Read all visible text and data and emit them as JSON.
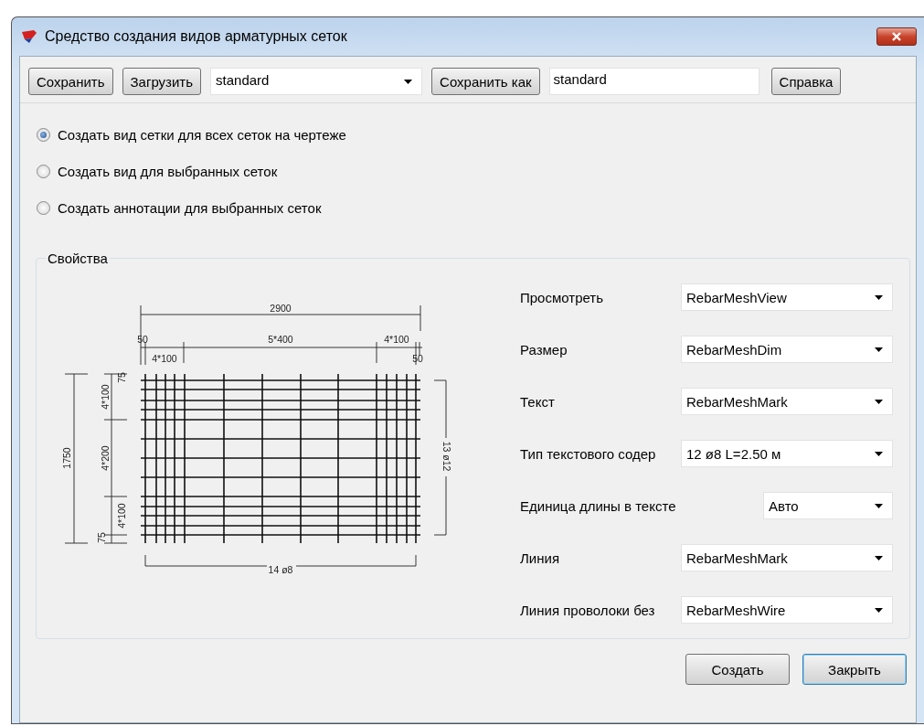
{
  "window": {
    "title": "Средство создания видов арматурных сеток"
  },
  "toolbar": {
    "save_button": "Сохранить",
    "load_button": "Загрузить",
    "preset_combo": {
      "value": "standard"
    },
    "save_as_button": "Сохранить как",
    "save_as_field": {
      "value": "standard"
    },
    "help_button": "Справка"
  },
  "modes": [
    {
      "label": "Создать вид сетки для всех сеток на чертеже",
      "selected": true
    },
    {
      "label": "Создать вид для выбранных сеток",
      "selected": false
    },
    {
      "label": "Создать аннотации для выбранных сеток",
      "selected": false
    }
  ],
  "properties": {
    "title": "Свойства",
    "preview": {
      "dimension_labels": [
        "2900",
        "50",
        "5*400",
        "4*100",
        "4*100",
        "50",
        "1750",
        "75",
        "4*100",
        "4*200",
        "4*100",
        "75",
        "13 ø12",
        "14 ø8"
      ]
    },
    "settings": [
      {
        "label": "Просмотреть",
        "value": "RebarMeshView",
        "kind": "wide"
      },
      {
        "label": "Размер",
        "value": "RebarMeshDim",
        "kind": "wide"
      },
      {
        "label": "Текст",
        "value": "RebarMeshMark",
        "kind": "wide"
      },
      {
        "label": "Тип текстового содер",
        "value": "12 ø8 L=2.50 м",
        "kind": "wide"
      },
      {
        "label": "Единица длины в тексте",
        "value": "Авто",
        "kind": "narrow"
      },
      {
        "label": "Линия",
        "value": "RebarMeshMark",
        "kind": "wide"
      },
      {
        "label": "Линия проволоки без",
        "value": "RebarMeshWire",
        "kind": "wide"
      }
    ]
  },
  "buttons": [
    {
      "label": "Создать",
      "default": false
    },
    {
      "label": "Закрыть",
      "default": true
    }
  ]
}
